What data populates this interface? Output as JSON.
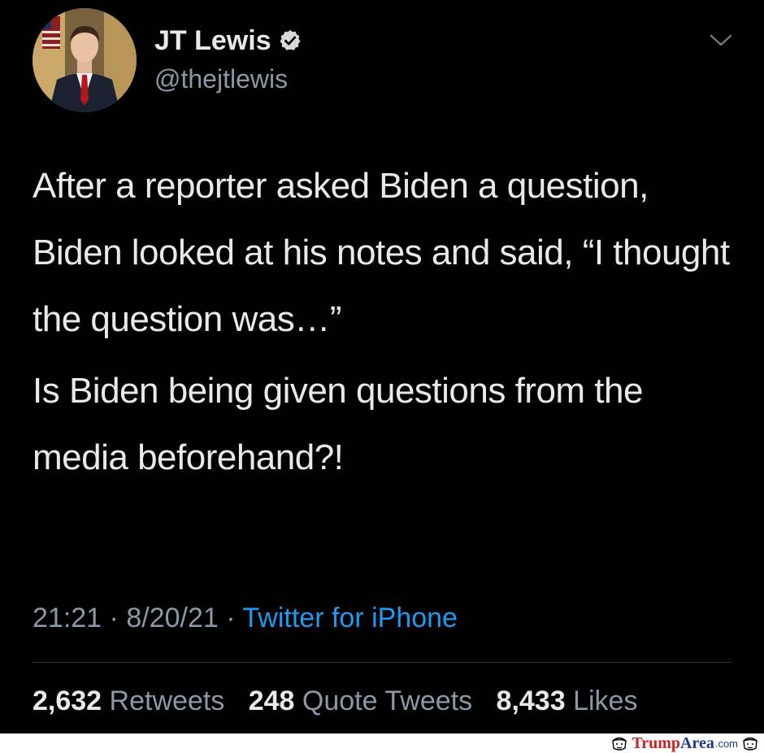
{
  "tweet": {
    "author": {
      "display_name": "JT Lewis",
      "handle": "@thejtlewis",
      "verified": true
    },
    "text_paragraph_1": "After a reporter asked Biden a question, Biden looked at his notes and said, “I thought the question was…”",
    "text_paragraph_2": "Is Biden being given questions from the media beforehand?!",
    "time": "21:21",
    "date": "8/20/21",
    "separator": "·",
    "source": "Twitter for iPhone",
    "stats": {
      "retweets_count": "2,632",
      "retweets_label": "Retweets",
      "quote_tweets_count": "248",
      "quote_tweets_label": "Quote Tweets",
      "likes_count": "8,433",
      "likes_label": "Likes"
    }
  },
  "watermark": {
    "part1": "Trump",
    "part2": "Area",
    "part3": ".com"
  },
  "colors": {
    "background": "#000000",
    "text_primary": "#e7e9ea",
    "text_secondary": "#8b98a5",
    "link": "#1d9bf0"
  },
  "icons": {
    "verified": "verified-badge-icon",
    "menu": "chevron-down-icon"
  }
}
